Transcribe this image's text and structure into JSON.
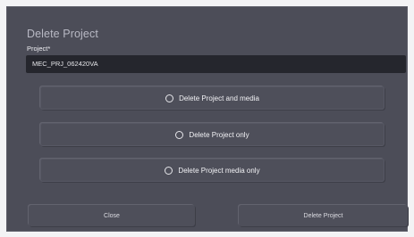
{
  "dialog": {
    "title": "Delete Project",
    "project_label": "Project*",
    "project_value": "MEC_PRJ_062420VA",
    "options": [
      {
        "label": "Delete Project and media",
        "selected": false
      },
      {
        "label": "Delete Project only",
        "selected": false
      },
      {
        "label": "Delete Project media only",
        "selected": false
      }
    ],
    "close_label": "Close",
    "delete_label": "Delete Project"
  },
  "colors": {
    "dialog_bg": "#4c4d58",
    "field_bg": "#25262d",
    "title_text": "#b8b9c4",
    "text": "#f2f2f5"
  },
  "icons": {
    "radio": "radio-unchecked-icon"
  }
}
